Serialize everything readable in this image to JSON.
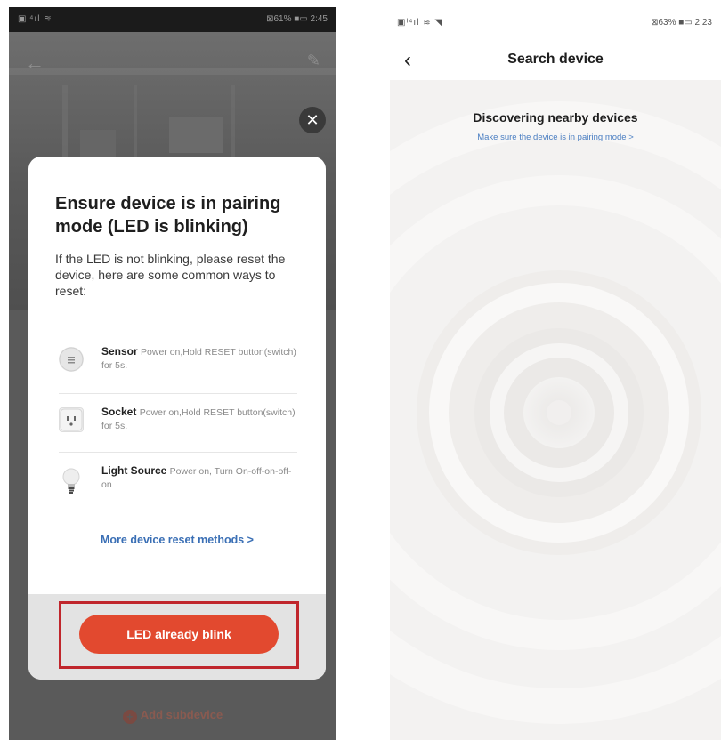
{
  "left_screen": {
    "status_bar": {
      "left": "▣ᴵ⁴ıl ≋",
      "right": "⊠61% ■▭ 2:45"
    },
    "dialog": {
      "title": "Ensure device is in pairing mode (LED is blinking)",
      "description": "If the LED is not blinking, please reset the device, here are some common ways to reset:",
      "methods": [
        {
          "name": "Sensor",
          "instruction": "Power on,Hold RESET button(switch) for 5s.",
          "icon": "sensor-icon"
        },
        {
          "name": "Socket",
          "instruction": "Power on,Hold RESET button(switch) for 5s.",
          "icon": "socket-icon"
        },
        {
          "name": "Light Source",
          "instruction": "Power on, Turn On-off-on-off-on",
          "icon": "bulb-icon"
        }
      ],
      "more_link": "More device reset methods >",
      "confirm_button": "LED already blink",
      "close_glyph": "✕"
    },
    "bottom_action": "Add subdevice",
    "accent_color": "#e2492f",
    "highlight_color": "#c0262c"
  },
  "right_screen": {
    "status_bar": {
      "left": "▣ᴵ⁴ıl ≋ ◥",
      "right": "⊠63% ■▭ 2:23"
    },
    "nav": {
      "back_glyph": "‹",
      "title": "Search device"
    },
    "discover_title": "Discovering nearby devices",
    "discover_hint": "Make sure the device is in pairing mode >",
    "link_color": "#4a7ec2"
  }
}
